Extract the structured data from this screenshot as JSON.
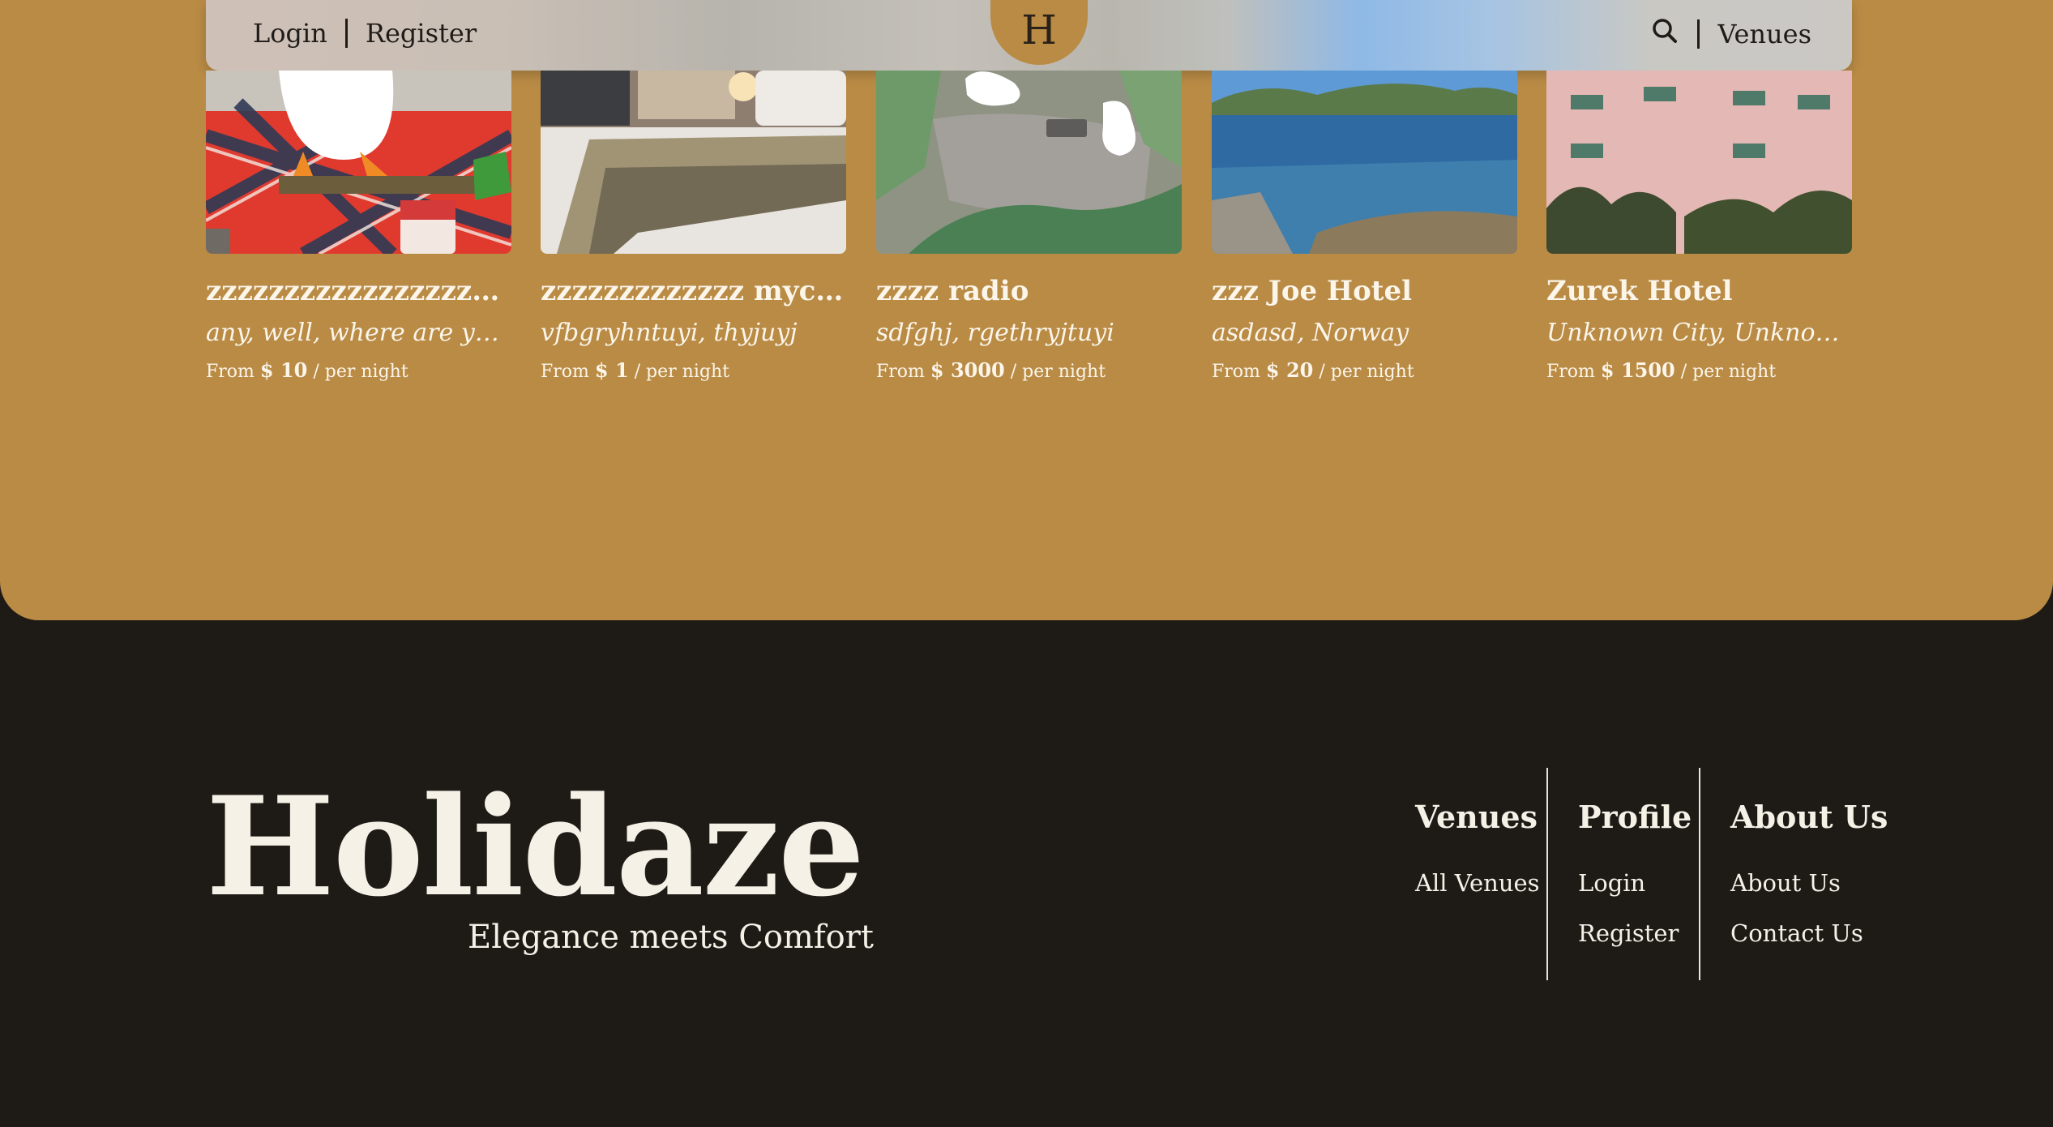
{
  "nav": {
    "login": "Login",
    "register": "Register",
    "logo_letter": "H",
    "venues": "Venues",
    "search_icon": "search-icon"
  },
  "cards": [
    {
      "title": "zzzzzzzzzzzzzzzzzzzzzz ...",
      "location": "any, well, where are you now?",
      "from": "From",
      "price": "$ 10",
      "per": "/ per night"
    },
    {
      "title": "zzzzzzzzzzzzz myceliu...",
      "location": "vfbgryhntuyi, thyjuyj",
      "from": "From",
      "price": "$ 1",
      "per": "/ per night"
    },
    {
      "title": "zzzz radio",
      "location": "sdfghj, rgethryjtuyi",
      "from": "From",
      "price": "$ 3000",
      "per": "/ per night"
    },
    {
      "title": "zzz Joe Hotel",
      "location": "asdasd, Norway",
      "from": "From",
      "price": "$ 20",
      "per": "/ per night"
    },
    {
      "title": "Zurek Hotel",
      "location": "Unknown City, Unknown Co...",
      "from": "From",
      "price": "$ 1500",
      "per": "/ per night"
    }
  ],
  "footer": {
    "brand": "Holidaze",
    "tagline": "Elegance meets Comfort",
    "columns": [
      {
        "heading": "Venues",
        "links": [
          "All Venues"
        ]
      },
      {
        "heading": "Profile",
        "links": [
          "Login",
          "Register"
        ]
      },
      {
        "heading": "About Us",
        "links": [
          "About Us",
          "Contact Us"
        ]
      }
    ]
  },
  "colors": {
    "gold": "#b98b45",
    "dark": "#1e1b17",
    "cream": "#f6f1e7"
  }
}
